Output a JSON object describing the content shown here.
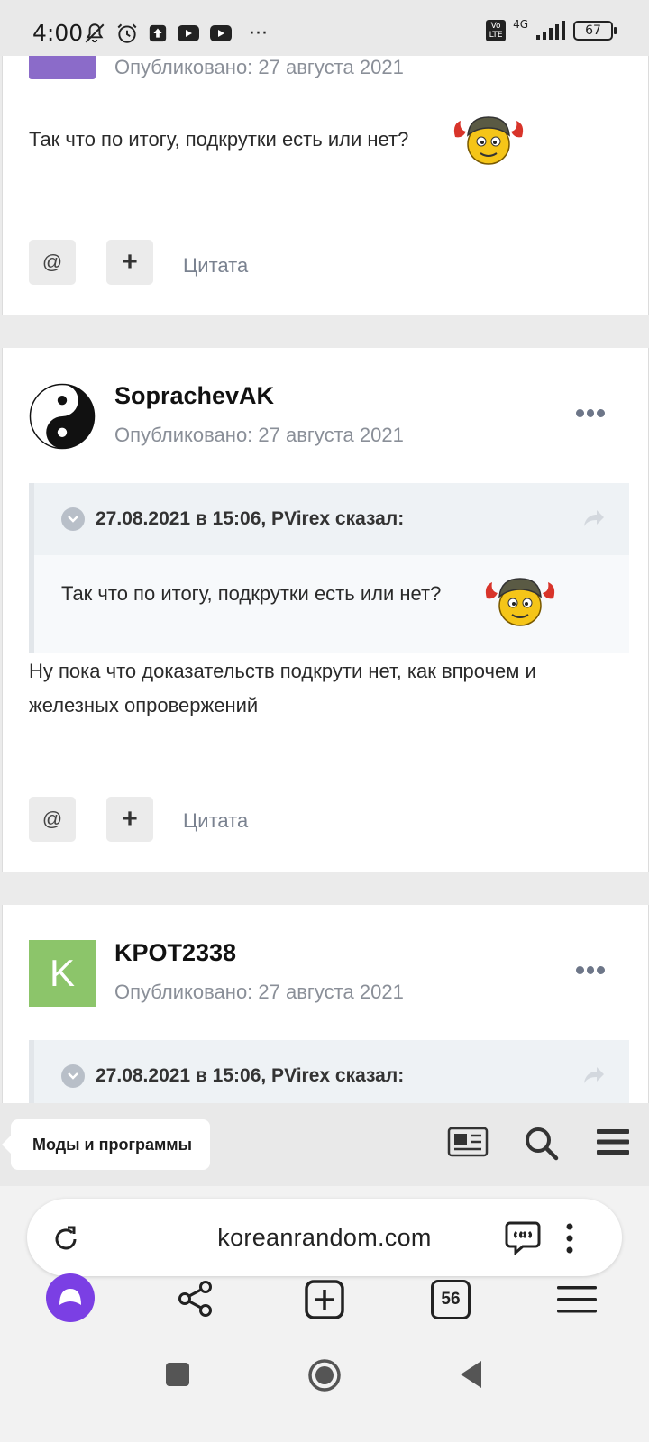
{
  "status_bar": {
    "time": "4:00",
    "network": "4G",
    "volte": "Vo LTE",
    "battery": "67",
    "more": "···"
  },
  "posts": [
    {
      "posted": "Опубликовано: 27 августа 2021",
      "text": "Так что по итогу, подкрутки есть или нет?",
      "actions": {
        "mention": "@",
        "plus": "+",
        "quote": "Цитата"
      }
    },
    {
      "author": "SoprachevAK",
      "posted": "Опубликовано: 27 августа 2021",
      "quote_header": "27.08.2021 в 15:06, PVirex сказал:",
      "quote_text": "Так что по итогу, подкрутки есть или нет?",
      "text": "Ну пока что доказательств подкрути нет, как впрочем и железных опровержений",
      "actions": {
        "mention": "@",
        "plus": "+",
        "quote": "Цитата"
      }
    },
    {
      "author": "KPOT2338",
      "avatar_letter": "K",
      "posted": "Опубликовано: 27 августа 2021",
      "quote_header": "27.08.2021 в 15:06, PVirex сказал:"
    }
  ],
  "site_nav": {
    "section": "Моды и программы"
  },
  "browser": {
    "url": "koreanrandom.com",
    "tabs_count": "56"
  },
  "colors": {
    "accent": "#7b3fe4",
    "avatar_k": "#8cc56a",
    "avatar_purple": "#8b6bc9"
  }
}
